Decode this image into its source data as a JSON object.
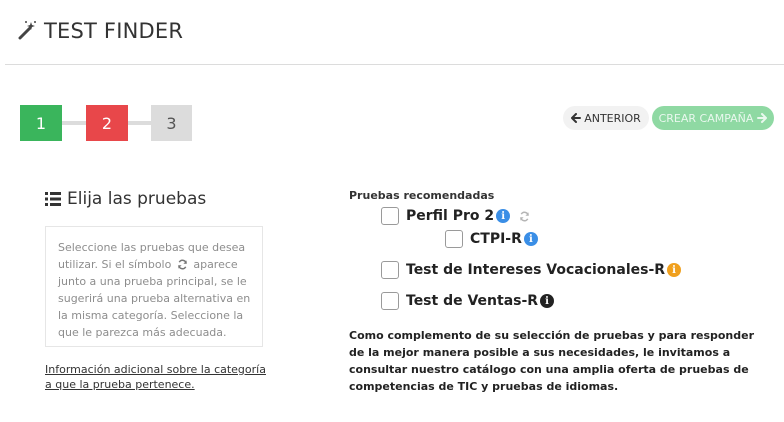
{
  "header": {
    "title": "TEST FINDER",
    "icon": "magic-wand-icon"
  },
  "steps": [
    {
      "label": "1",
      "color": "#3ab55c",
      "state": "completed"
    },
    {
      "label": "2",
      "color": "#e8474a",
      "state": "current"
    },
    {
      "label": "3",
      "color": "#dcdcdc",
      "state": "pending"
    }
  ],
  "nav": {
    "prev_label": "ANTERIOR",
    "next_label": "CREAR CAMPAÑA",
    "next_color": "#8fd9a3"
  },
  "left": {
    "section_title": "Elija las pruebas",
    "help_before": "Seleccione las pruebas que desea utilizar. Si el símbolo",
    "help_after": "aparece junto a una prueba principal, se le sugerirá una prueba alternativa en la misma categoría. Seleccione la que le parezca más adecuada.",
    "info_link": "Información adicional sobre la categoría a que la prueba pertenece."
  },
  "right": {
    "recommended_label": "Pruebas recomendadas",
    "tests": [
      {
        "name": "Perfil Pro 2",
        "checked": false,
        "info_color": "#3a8ee6",
        "has_alternative": true
      },
      {
        "name": "CTPI-R",
        "checked": false,
        "info_color": "#3a8ee6"
      },
      {
        "name": "Test de Intereses Vocacionales-R",
        "checked": false,
        "info_color": "#f0a01e"
      },
      {
        "name": "Test de Ventas-R",
        "checked": false,
        "info_color": "#222222"
      }
    ],
    "note": "Como complemento de su selección de pruebas y para responder de la mejor manera posible a sus necesidades, le invitamos a consultar nuestro catálogo con una amplia oferta de pruebas de competencias de TIC y pruebas de idiomas."
  }
}
